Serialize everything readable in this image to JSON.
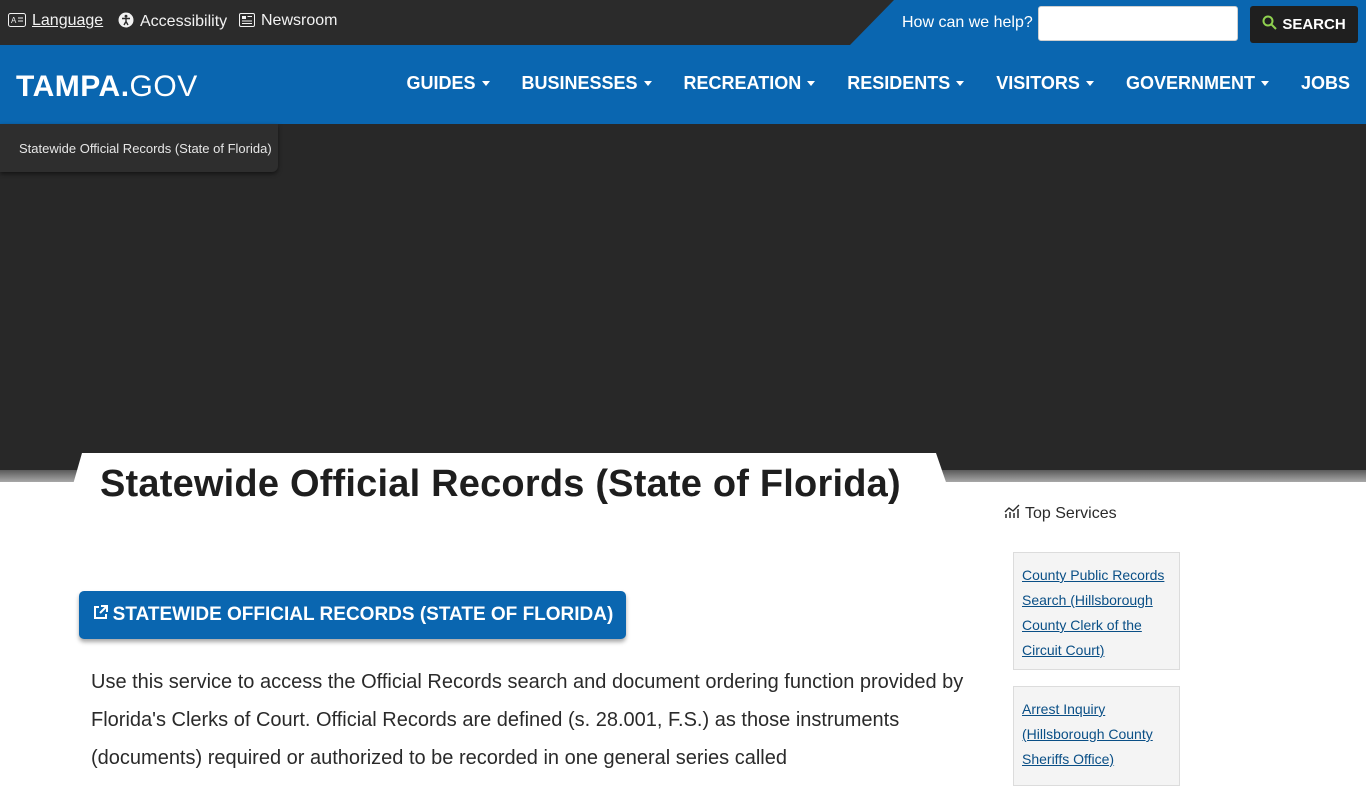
{
  "utility": {
    "language": "Language",
    "accessibility": "Accessibility",
    "newsroom": "Newsroom",
    "help_label": "How can we help?",
    "search_placeholder": "",
    "search_button": "SEARCH"
  },
  "brand": {
    "logo_bold": "TAMPA.",
    "logo_light": "GOV"
  },
  "nav": {
    "items": [
      {
        "label": "GUIDES"
      },
      {
        "label": "BUSINESSES"
      },
      {
        "label": "RECREATION"
      },
      {
        "label": "RESIDENTS"
      },
      {
        "label": "VISITORS"
      },
      {
        "label": "GOVERNMENT"
      },
      {
        "label": "JOBS"
      }
    ]
  },
  "breadcrumb": "Statewide Official Records (State of Florida)",
  "page": {
    "title": "Statewide Official Records (State of Florida)",
    "cta": "STATEWIDE OFFICIAL RECORDS (STATE OF FLORIDA)",
    "body": "Use this service to access the Official Records search and document ordering function provided by Florida's Clerks of Court. Official Records are defined (s. 28.001, F.S.) as those instruments (documents) required or authorized to be recorded in one general series called"
  },
  "sidebar": {
    "heading": "Top Services",
    "services": [
      {
        "label": "County Public Records Search (Hillsborough County Clerk of the Circuit Court)"
      },
      {
        "label": "Arrest Inquiry (Hillsborough County Sheriffs Office)"
      }
    ]
  },
  "colors": {
    "primary_blue": "#0a66b0",
    "dark_bar": "#2b2b2b",
    "hero": "#282828"
  },
  "icons": [
    "language-icon",
    "accessibility-icon",
    "newsroom-icon",
    "search-icon",
    "external-link-icon",
    "chart-icon"
  ]
}
